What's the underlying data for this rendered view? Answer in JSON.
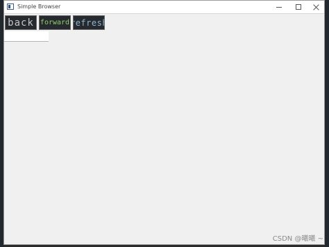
{
  "window": {
    "title": "Simple Browser",
    "controls": {
      "minimize": "minimize",
      "maximize": "maximize",
      "close": "close"
    }
  },
  "toolbar": {
    "back_label": "back",
    "forward_label": "forward",
    "refresh_label": "refresh"
  },
  "url_bar": {
    "value": ""
  },
  "watermark": {
    "text": "CSDN @曦曦 ~"
  },
  "colors": {
    "button_bg": "#262a2f",
    "window_bg": "#f0f0f0",
    "titlebar_bg": "#ffffff"
  },
  "icons": {
    "app_icon": "window-app-icon",
    "minimize": "minimize-icon",
    "maximize": "maximize-icon",
    "close": "close-icon"
  }
}
